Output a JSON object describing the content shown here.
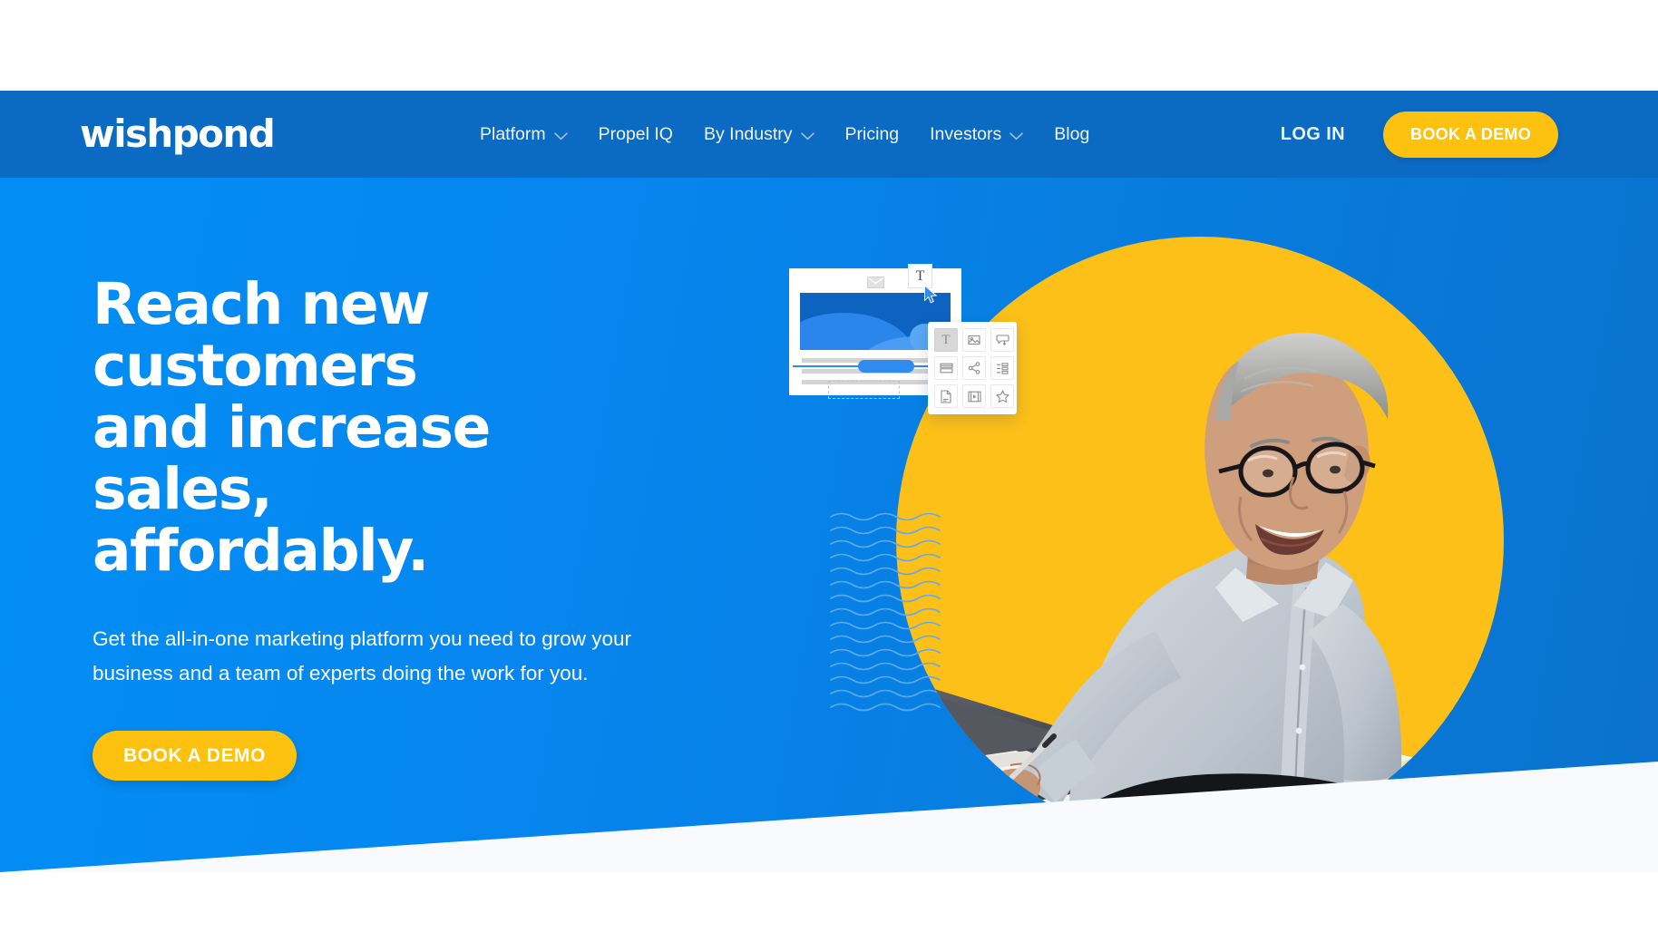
{
  "brand": {
    "logo_text": "wishpond",
    "accent_yellow": "#fdc110",
    "header_blue": "#0b6ac2",
    "hero_blue": "#0586ef",
    "circle_yellow": "#fcc019"
  },
  "header": {
    "nav_items": [
      {
        "label": "Platform",
        "has_dropdown": true,
        "icon": "chevron-down-icon"
      },
      {
        "label": "Propel IQ",
        "has_dropdown": false,
        "icon": ""
      },
      {
        "label": "By Industry",
        "has_dropdown": true,
        "icon": "chevron-down-icon"
      },
      {
        "label": "Pricing",
        "has_dropdown": false,
        "icon": ""
      },
      {
        "label": "Investors",
        "has_dropdown": true,
        "icon": "chevron-down-icon"
      },
      {
        "label": "Blog",
        "has_dropdown": false,
        "icon": ""
      }
    ],
    "login_label": "LOG IN",
    "cta_label": "BOOK A DEMO"
  },
  "hero": {
    "headline": "Reach new customers\nand increase sales,\naffordably.",
    "subhead": "Get the all-in-one marketing platform you need to grow your business and a team of experts doing the work for you.",
    "cta_label": "BOOK A DEMO"
  },
  "art": {
    "mockup": {
      "header_icon": "envelope-icon",
      "text_tool_chip": "T",
      "cursor_icon": "mouse-pointer-icon"
    },
    "palette_tools": [
      {
        "name": "text-tool",
        "icon": "text-t-icon",
        "active": true
      },
      {
        "name": "image-tool",
        "icon": "image-icon",
        "active": false
      },
      {
        "name": "callout-tool",
        "icon": "speech-bubble-icon",
        "active": false
      },
      {
        "name": "button-tool",
        "icon": "stacked-bars-icon",
        "active": false
      },
      {
        "name": "share-tool",
        "icon": "share-icon",
        "active": false
      },
      {
        "name": "settings-tool",
        "icon": "sliders-icon",
        "active": false
      },
      {
        "name": "document-tool",
        "icon": "document-icon",
        "active": false
      },
      {
        "name": "video-tool",
        "icon": "video-icon",
        "active": false
      },
      {
        "name": "favorite-tool",
        "icon": "star-icon",
        "active": false
      }
    ]
  }
}
